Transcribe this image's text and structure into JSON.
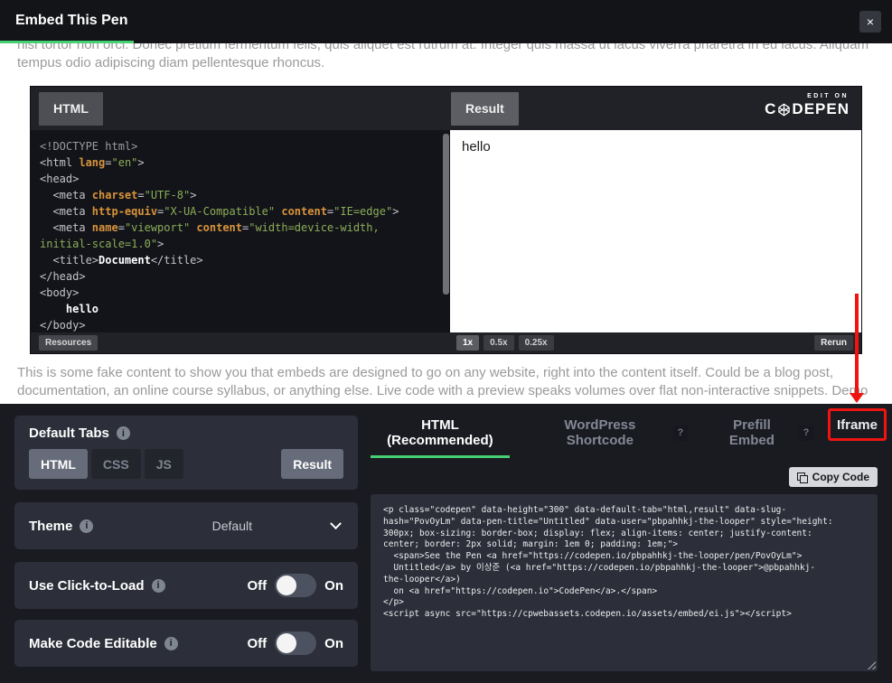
{
  "modal": {
    "title": "Embed This Pen"
  },
  "icons": {
    "close": "×",
    "info": "i",
    "help": "?",
    "copy": "overlapping-squares-css",
    "chevron_down": "css-chevron",
    "codepen_logo": "svg-hexagon-cube",
    "resize_handle": "css-diagonal-stripes"
  },
  "fake_content": {
    "top_paragraph": "nisl tortor non orci. Donec pretium fermentum felis, quis aliquet est rutrum at. Integer quis massa ut lacus viverra pharetra in eu lacus. Aliquam tempus odio adipiscing diam pellentesque rhoncus.",
    "bottom_paragraph": "This is some fake content to show you that embeds are designed to go on any website, right into the content itself. Could be a blog post, documentation, an online course syllabus, or anything else. Live code with a preview speaks volumes over flat non-interactive snippets. Demo"
  },
  "embed_preview": {
    "html_tab": "HTML",
    "result_tab": "Result",
    "edit_on_label": "EDIT ON",
    "logo_before": "C",
    "logo_after": "DEPEN",
    "result_output": "hello",
    "editor_lines": [
      [
        [
          "doc",
          "<!DOCTYPE html>"
        ]
      ],
      [
        [
          "tag",
          "<html "
        ],
        [
          "attr",
          "lang"
        ],
        [
          "tag",
          "="
        ],
        [
          "str",
          "\"en\""
        ],
        [
          "tag",
          ">"
        ]
      ],
      [
        [
          "tag",
          "<head>"
        ]
      ],
      [
        [
          "tag",
          "  <meta "
        ],
        [
          "attr",
          "charset"
        ],
        [
          "tag",
          "="
        ],
        [
          "str",
          "\"UTF-8\""
        ],
        [
          "tag",
          ">"
        ]
      ],
      [
        [
          "tag",
          "  <meta "
        ],
        [
          "attr",
          "http-equiv"
        ],
        [
          "tag",
          "="
        ],
        [
          "str",
          "\"X-UA-Compatible\""
        ],
        [
          "tag",
          " "
        ],
        [
          "attr",
          "content"
        ],
        [
          "tag",
          "="
        ],
        [
          "str",
          "\"IE=edge\""
        ],
        [
          "tag",
          ">"
        ]
      ],
      [
        [
          "tag",
          "  <meta "
        ],
        [
          "attr",
          "name"
        ],
        [
          "tag",
          "="
        ],
        [
          "str",
          "\"viewport\""
        ],
        [
          "tag",
          " "
        ],
        [
          "attr",
          "content"
        ],
        [
          "tag",
          "="
        ],
        [
          "str",
          "\"width=device-width,"
        ]
      ],
      [
        [
          "str",
          "initial-scale=1.0\""
        ],
        [
          "tag",
          ">"
        ]
      ],
      [
        [
          "tag",
          "  <title>"
        ],
        [
          "txt",
          "Document"
        ],
        [
          "tag",
          "</title>"
        ]
      ],
      [
        [
          "tag",
          "</head>"
        ]
      ],
      [
        [
          "tag",
          "<body>"
        ]
      ],
      [
        [
          "txt",
          "    hello"
        ]
      ],
      [
        [
          "tag",
          "</body>"
        ]
      ]
    ],
    "footer": {
      "resources_label": "Resources",
      "zoom_buttons": [
        "1x",
        "0.5x",
        "0.25x"
      ],
      "rerun_label": "Rerun"
    }
  },
  "options_panel": {
    "default_tabs": {
      "label": "Default Tabs",
      "tab_buttons": [
        "HTML",
        "CSS",
        "JS"
      ],
      "active_tab": "HTML",
      "result_button": "Result"
    },
    "theme": {
      "label": "Theme",
      "selected": "Default"
    },
    "click_to_load": {
      "label": "Use Click-to-Load",
      "off_label": "Off",
      "on_label": "On",
      "state": "off"
    },
    "code_editable": {
      "label": "Make Code Editable",
      "off_label": "Off",
      "on_label": "On",
      "state": "off"
    }
  },
  "embed_code_panel": {
    "tabs": [
      {
        "label": "HTML (Recommended)"
      },
      {
        "label": "WordPress Shortcode"
      },
      {
        "label": "Prefill Embed"
      },
      {
        "label": "Iframe"
      }
    ],
    "active_tab": "HTML (Recommended)",
    "copy_button_label": "Copy Code",
    "code": "<p class=\"codepen\" data-height=\"300\" data-default-tab=\"html,result\" data-slug-\nhash=\"PovOyLm\" data-pen-title=\"Untitled\" data-user=\"pbpahhkj-the-looper\" style=\"height:\n300px; box-sizing: border-box; display: flex; align-items: center; justify-content:\ncenter; border: 2px solid; margin: 1em 0; padding: 1em;\">\n  <span>See the Pen <a href=\"https://codepen.io/pbpahhkj-the-looper/pen/PovOyLm\">\n  Untitled</a> by 이상준 (<a href=\"https://codepen.io/pbpahhkj-the-looper\">@pbpahhkj-\nthe-looper</a>)\n  on <a href=\"https://codepen.io\">CodePen</a>.</span>\n</p>\n<script async src=\"https://cpwebassets.codepen.io/assets/embed/ei.js\"></script>"
  },
  "annotations": {
    "type": "red-arrow-pointing-to-box",
    "target_tab": "Iframe",
    "color": "#ef1410"
  },
  "colors": {
    "accent_green": "#47cf73",
    "annotation_red": "#ef1410",
    "modal_header_bg": "#131417",
    "dark_section_bg": "#191b21",
    "panel_bg": "#2c2f39"
  }
}
